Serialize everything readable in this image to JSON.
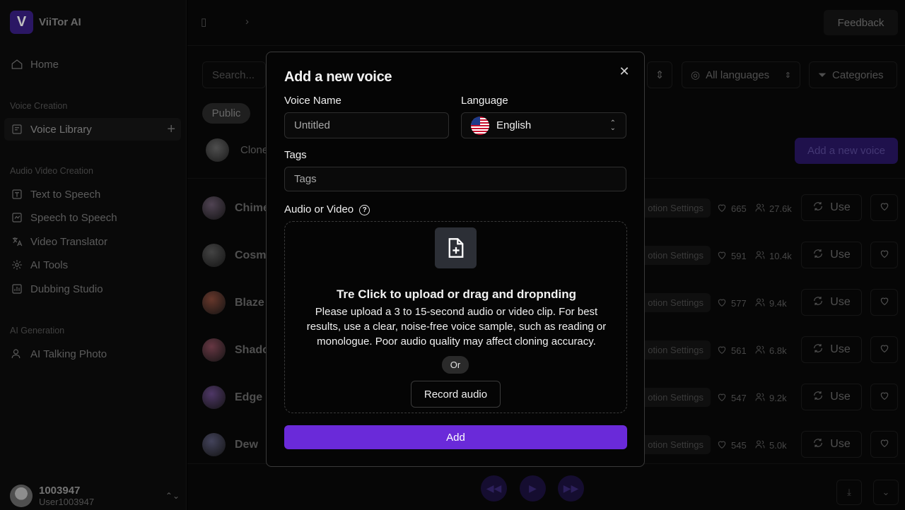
{
  "app": {
    "name": "ViiTor AI",
    "logo_letter": "V"
  },
  "sidebar": {
    "home": "Home",
    "sections": [
      {
        "label": "Voice Creation"
      },
      {
        "label": "Audio Video Creation"
      },
      {
        "label": "AI Generation"
      }
    ],
    "voice_library": "Voice Library",
    "items_av": [
      "Text to Speech",
      "Speech to Speech",
      "Video Translator",
      "AI Tools",
      "Dubbing Studio"
    ],
    "items_ai": [
      "AI Talking Photo"
    ],
    "user": {
      "id": "1003947",
      "handle": "User1003947"
    }
  },
  "topbar": {
    "feedback_label": "Feedback"
  },
  "library": {
    "search_placeholder": "Search...",
    "languages_label": "All languages",
    "categories_label": "Categories",
    "public_tab": "Public",
    "clone_label": "Clone",
    "add_voice_label": "Add a new voice",
    "emotion_label": "otion Settings",
    "use_label": "Use",
    "voices": [
      {
        "name": "Chime",
        "likes": "665",
        "users": "27.6k",
        "color": "#6b5a6f"
      },
      {
        "name": "Cosmo",
        "likes": "591",
        "users": "10.4k",
        "color": "#5a5a5a"
      },
      {
        "name": "Blaze",
        "likes": "577",
        "users": "9.4k",
        "color": "#8a4a3a"
      },
      {
        "name": "Shado",
        "likes": "561",
        "users": "6.8k",
        "color": "#8a4a5a"
      },
      {
        "name": "Edge",
        "likes": "547",
        "users": "9.2k",
        "color": "#6a4a8a"
      },
      {
        "name": "Dew",
        "likes": "545",
        "users": "5.0k",
        "color": "#5a5a7a"
      }
    ]
  },
  "modal": {
    "title": "Add a new voice",
    "voice_name_label": "Voice Name",
    "voice_name_placeholder": "Untitled",
    "language_label": "Language",
    "language_value": "English",
    "tags_label": "Tags",
    "tags_placeholder": "Tags",
    "audio_label": "Audio or Video",
    "upload_title": "Tre Click to upload or drag and dropnding",
    "upload_desc": "Please upload a 3 to 15-second audio or video clip. For best results, use a clear, noise-free voice sample, such as reading or monologue. Poor audio quality may affect cloning accuracy.",
    "or_label": "Or",
    "record_label": "Record audio",
    "add_label": "Add"
  },
  "colors": {
    "accent": "#6a2ad9",
    "background": "#000000"
  }
}
